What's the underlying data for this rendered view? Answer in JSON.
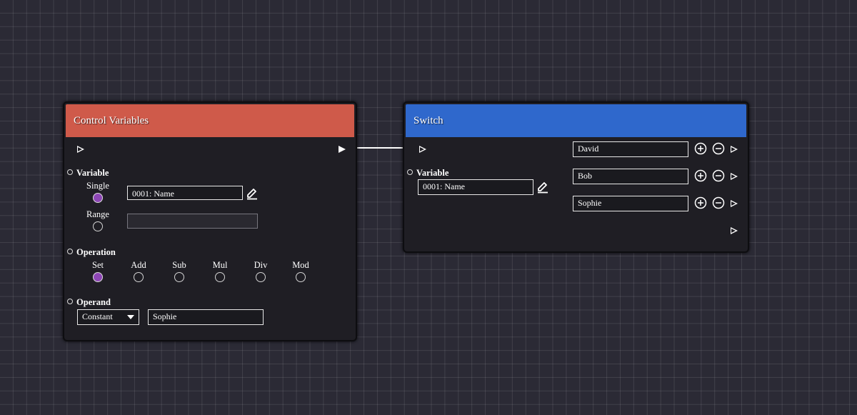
{
  "canvas": {
    "grid": true,
    "edge_color": "#ffffff"
  },
  "control_variables_node": {
    "title": "Control Variables",
    "header_color": "#cf5a4a",
    "variable": {
      "label": "Variable",
      "single_label": "Single",
      "range_label": "Range",
      "selected": "Single",
      "single_value": "0001: Name",
      "range_value": ""
    },
    "operation": {
      "label": "Operation",
      "options": [
        "Set",
        "Add",
        "Sub",
        "Mul",
        "Div",
        "Mod"
      ],
      "selected": "Set"
    },
    "operand": {
      "label": "Operand",
      "type_value": "Constant",
      "value": "Sophie"
    },
    "selected_color": "#8d46b5"
  },
  "switch_node": {
    "title": "Switch",
    "header_color": "#2f68cc",
    "variable": {
      "label": "Variable",
      "value": "0001: Name"
    },
    "cases": [
      "David",
      "Bob",
      "Sophie"
    ]
  }
}
